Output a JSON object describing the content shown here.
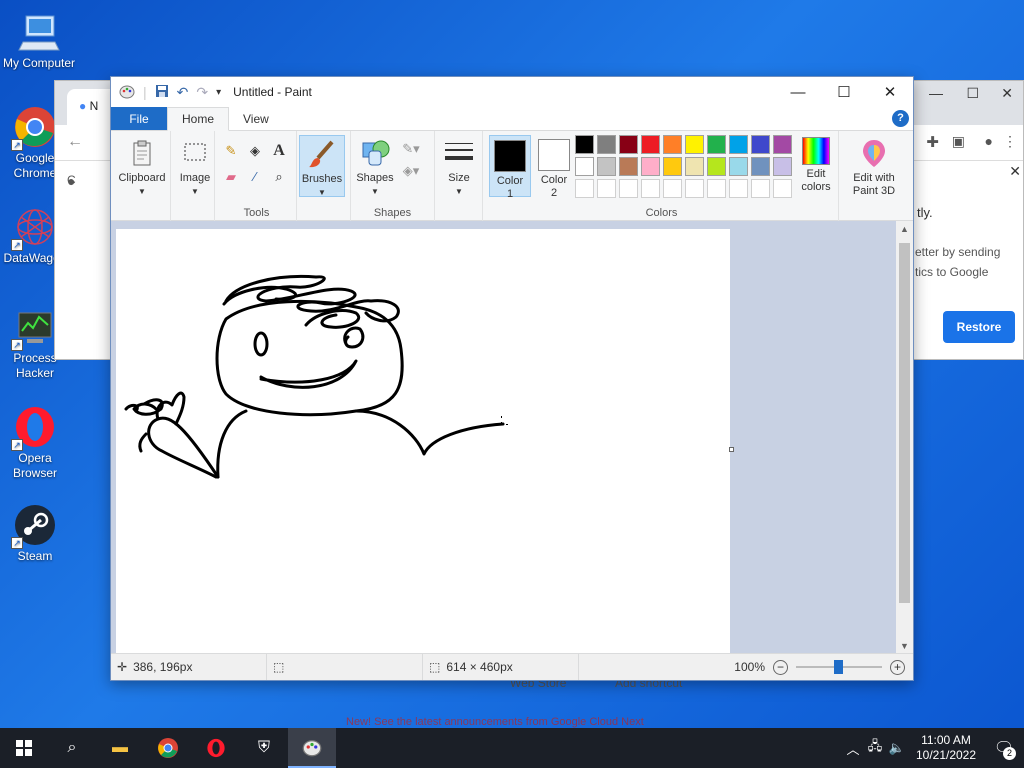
{
  "desktop": {
    "icons": [
      {
        "label": "My Computer"
      },
      {
        "label": "Google Chrome"
      },
      {
        "label": "DataWagon"
      },
      {
        "label": "Process Hacker"
      },
      {
        "label": "Opera Browser"
      },
      {
        "label": "Steam"
      }
    ]
  },
  "chrome": {
    "tab_text": "N",
    "omnibox_text": "C",
    "side_text_1": "tly.",
    "side_text_2": "etter by sending",
    "side_text_3": "tics to Google",
    "restore_label": "Restore",
    "bottom_labels": [
      "Web Store",
      "Add shortcut"
    ],
    "banner_text": "New! See the latest announcements from Google Cloud Next"
  },
  "paint": {
    "title": "Untitled - Paint",
    "tabs": {
      "file": "File",
      "home": "Home",
      "view": "View"
    },
    "ribbon": {
      "clipboard": "Clipboard",
      "image": "Image",
      "tools_label": "Tools",
      "brushes": "Brushes",
      "shapes_btn": "Shapes",
      "shapes_label": "Shapes",
      "size": "Size",
      "color1": "Color\n1",
      "color1_a": "Color",
      "color1_b": "1",
      "color2_a": "Color",
      "color2_b": "2",
      "colors_label": "Colors",
      "edit_colors_a": "Edit",
      "edit_colors_b": "colors",
      "paint3d_a": "Edit with",
      "paint3d_b": "Paint 3D"
    },
    "palette_row1": [
      "#000000",
      "#7f7f7f",
      "#880015",
      "#ed1c24",
      "#ff7f27",
      "#fff200",
      "#22b14c",
      "#00a2e8",
      "#3f48cc",
      "#a349a4"
    ],
    "palette_row2": [
      "#ffffff",
      "#c3c3c3",
      "#b97a57",
      "#ffaec9",
      "#ffc90e",
      "#efe4b0",
      "#b5e61d",
      "#99d9ea",
      "#7092be",
      "#c8bfe7"
    ],
    "status": {
      "cursor_pos": "386, 196px",
      "canvas_size": "614 × 460px",
      "zoom": "100%"
    }
  },
  "taskbar": {
    "time": "11:00 AM",
    "date": "10/21/2022",
    "notification_count": "2"
  }
}
